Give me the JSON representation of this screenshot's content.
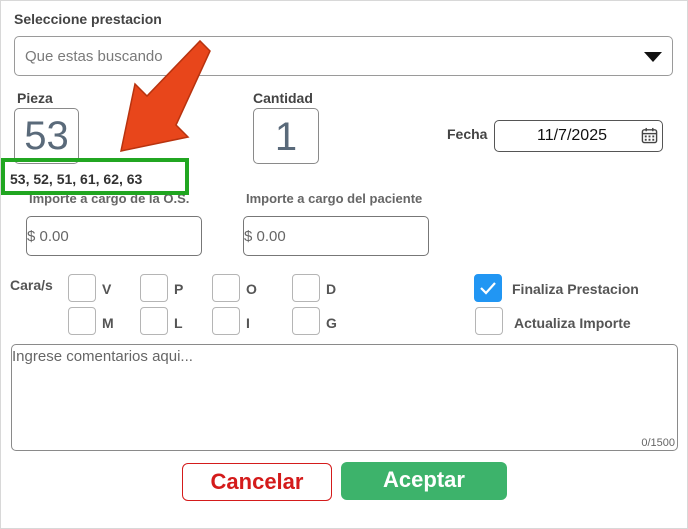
{
  "form": {
    "prestacion_label": "Seleccione prestacion",
    "prestacion_placeholder": "Que estas buscando",
    "pieza_label": "Pieza",
    "pieza_value": "53",
    "cantidad_label": "Cantidad",
    "cantidad_value": "1",
    "fecha_label": "Fecha",
    "fecha_value": "11/7/2025",
    "piezas_list": "53, 52, 51, 61, 62, 63",
    "importe_os_label": "Importe a cargo de la O.S.",
    "importe_os_value": "$ 0.00",
    "importe_pac_label": "Importe a cargo del paciente",
    "importe_pac_value": "$ 0.00",
    "caras_label": "Cara/s",
    "caras": [
      {
        "label": "V",
        "checked": false
      },
      {
        "label": "P",
        "checked": false
      },
      {
        "label": "O",
        "checked": false
      },
      {
        "label": "D",
        "checked": false
      },
      {
        "label": "M",
        "checked": false
      },
      {
        "label": "L",
        "checked": false
      },
      {
        "label": "I",
        "checked": false
      },
      {
        "label": "G",
        "checked": false
      }
    ],
    "finaliza_label": "Finaliza Prestacion",
    "finaliza_checked": true,
    "actualiza_label": "Actualiza Importe",
    "actualiza_checked": false,
    "comentarios_placeholder": "Ingrese comentarios aqui...",
    "comentarios_counter": "0/1500",
    "cancel_label": "Cancelar",
    "accept_label": "Aceptar"
  },
  "colors": {
    "cancel": "#d41b1b",
    "accept": "#3db36b",
    "checkbox_on": "#2196f3",
    "highlight": "#21a621",
    "arrow": "#e8461b"
  },
  "annotation": {
    "icon": "arrow-annotation-icon"
  }
}
